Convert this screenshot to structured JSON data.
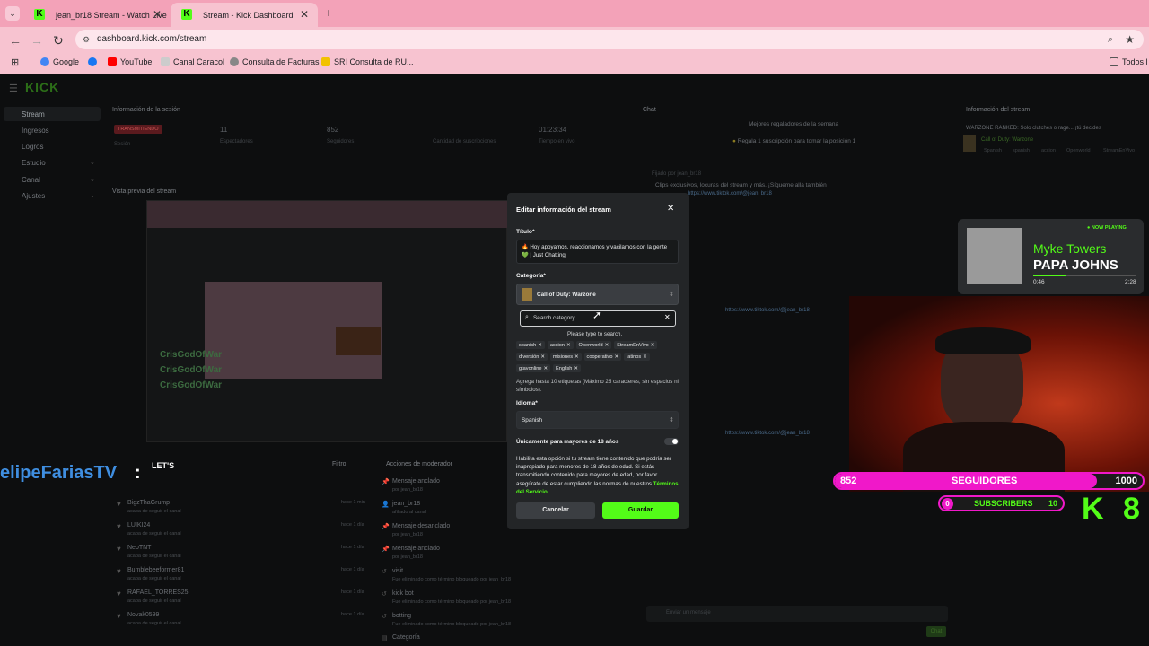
{
  "browser": {
    "tabs": [
      {
        "title": "jean_br18 Stream - Watch Live",
        "active": false
      },
      {
        "title": "Stream - Kick Dashboard",
        "active": true
      }
    ],
    "url": "dashboard.kick.com/stream",
    "bookmarks": [
      "Google",
      "YouTube",
      "Canal Caracol",
      "Consulta de Facturas",
      "SRI Consulta de RU...",
      "Todos l"
    ]
  },
  "dashboard": {
    "logo": "KICK",
    "sidebar": [
      "Stream",
      "Ingresos",
      "Logros",
      "Estudio",
      "Canal",
      "Ajustes"
    ],
    "session": {
      "title": "Información de la sesión",
      "badge": "TRANSMITIENDO",
      "stats": [
        {
          "value": "",
          "label": "Sesión"
        },
        {
          "value": "11",
          "label": "Espectadores"
        },
        {
          "value": "852",
          "label": "Seguidores"
        },
        {
          "value": "",
          "label": "Cantidad de suscripciones"
        },
        {
          "value": "01:23:34",
          "label": "Tiempo en vivo"
        }
      ]
    },
    "preview_title": "Vista previa del stream",
    "chat": {
      "title": "Chat",
      "top_gifters": "Mejores regaladores de la semana",
      "gift_cta": "Regala 1 suscripción para tomar la posición 1",
      "pinned_by": "Fijado por",
      "pinned_user": "jean_br18",
      "pinned_msg": "Clips exclusivos, locuras del stream y más. ¡Sígueme allá también !",
      "link": "https://www.tiktok.com/@jean_br18",
      "input_placeholder": "Enviar un mensaje",
      "send": "Chat"
    },
    "stream_info": {
      "title": "Información del stream",
      "stream_title": "WARZONE RANKED: Solo clutches o rage... ¡tú decides",
      "category": "Call of Duty: Warzone",
      "tags": [
        "Spanish",
        "spanish",
        "accion",
        "Openworld",
        "StreamEnVivo"
      ]
    },
    "followers_panel": {
      "title": "Filtro",
      "rows": [
        {
          "name": "BigzThaGrump",
          "sub": "acaba de seguir el canal",
          "time": "hace 1 min"
        },
        {
          "name": "LUIKI24",
          "sub": "acaba de seguir el canal",
          "time": "hace 1 día"
        },
        {
          "name": "NeoTNT",
          "sub": "acaba de seguir el canal",
          "time": "hace 1 día"
        },
        {
          "name": "Bumblebeeformer81",
          "sub": "acaba de seguir el canal",
          "time": "hace 1 día"
        },
        {
          "name": "RAFAEL_TORRES25",
          "sub": "acaba de seguir el canal",
          "time": "hace 1 día"
        },
        {
          "name": "Novak0599",
          "sub": "acaba de seguir el canal",
          "time": "hace 1 día"
        }
      ]
    },
    "mod_actions": {
      "title": "Acciones de moderador",
      "rows": [
        {
          "name": "Mensaje anclado",
          "sub": "por jean_br18"
        },
        {
          "name": "jean_br18",
          "sub": "afiliado al canal"
        },
        {
          "name": "Mensaje desanclado",
          "sub": "por jean_br18"
        },
        {
          "name": "Mensaje anclado",
          "sub": "por jean_br18"
        },
        {
          "name": "visit",
          "sub": "Fue eliminado como término bloqueado por jean_br18"
        },
        {
          "name": "kick bot",
          "sub": "Fue eliminado como término bloqueado por jean_br18"
        },
        {
          "name": "botting",
          "sub": "Fue eliminado como término bloqueado por jean_br18"
        },
        {
          "name": "Categoría",
          "sub": ""
        }
      ]
    }
  },
  "modal": {
    "title": "Editar información del stream",
    "title_label": "Título*",
    "title_value": "🔥 Hoy apoyamos, reaccionamos y vacilamos con la gente 💚 | Just Chatting",
    "category_label": "Categoría*",
    "category_value": "Call of Duty: Warzone",
    "search_placeholder": "Search category...",
    "search_hint": "Please type to search.",
    "tags": [
      "spanish",
      "accion",
      "Openworld",
      "StreamEnVivo",
      "diversión",
      "misiones",
      "cooperativo",
      "latinos",
      "gtavonline",
      "English"
    ],
    "tags_help": "Agrega hasta 10 etiquetas (Máximo 25 caracteres, sin espacios ni símbolos).",
    "language_label": "Idioma*",
    "language_value": "Spanish",
    "adult_label": "Únicamente para mayores de 18 años",
    "adult_help": "Habilita esta opción si tu stream tiene contenido que podría ser inapropiado para menores de 18 años de edad. Si estás transmitiendo contenido para mayores de edad, por favor asegúrate de estar cumpliendo las normas de nuestros",
    "terms_link": "Términos del Servicio.",
    "cancel": "Cancelar",
    "save": "Guardar"
  },
  "overlay": {
    "now_playing_badge": "NOW PLAYING",
    "artist": "Myke Towers",
    "song": "PAPA JOHNS",
    "elapsed": "0:46",
    "duration": "2:28",
    "progress": 0.31,
    "followers_count": "852",
    "followers_label": "SEGUIDORES",
    "followers_goal": "1000",
    "followers_progress": 0.852,
    "subs_count": "0",
    "subs_label": "SUBSCRIBERS",
    "subs_goal": "10",
    "brand": "K 8",
    "left_name": "elipeFariasTV",
    "left_colon": ":",
    "left_msg": "LET'S",
    "chat_users": [
      "CrisGodOfWar",
      "CrisGodOfWar",
      "CrisGodOfWar"
    ],
    "accent": "#53fc18",
    "magenta": "#f018c9"
  }
}
